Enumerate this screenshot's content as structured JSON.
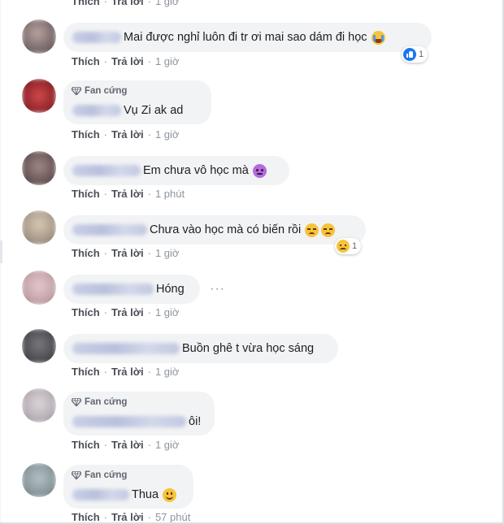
{
  "actions": {
    "like_label": "Thích",
    "reply_label": "Trả lời",
    "separator": "·"
  },
  "badge": {
    "label": "Fan cứng"
  },
  "comments": [
    {
      "time": "1 giờ"
    },
    {
      "message": "Mai được nghỉ luôn đi tr ơi mai sao dám đi học",
      "emoji": "crying-face",
      "time": "1 giờ",
      "reaction": {
        "icon": "like-icon",
        "count": "1"
      }
    },
    {
      "badge": true,
      "message": "Vụ Zi ak ad",
      "time": "1 giờ"
    },
    {
      "message": "Em chưa vô học mà",
      "emoji": "purple-face",
      "time": "1 phút"
    },
    {
      "message": "Chưa vào học mà có biến rồi",
      "emoji": "disappointed-face",
      "time": "1 giờ",
      "reaction": {
        "icon": "sad-react-icon",
        "count": "1"
      }
    },
    {
      "message": "Hóng",
      "time": "1 giờ",
      "more": "···"
    },
    {
      "message": "Buồn ghê t vừa học sáng",
      "time": "1 giờ"
    },
    {
      "badge": true,
      "message": "ôi!",
      "time": "1 giờ"
    },
    {
      "badge": true,
      "message": "Thua",
      "emoji": "smiling-face",
      "time": "57 phút"
    }
  ],
  "colors": {
    "bubble": "#f2f3f5",
    "action_text": "#606770",
    "like_blue": "#1877f2"
  }
}
